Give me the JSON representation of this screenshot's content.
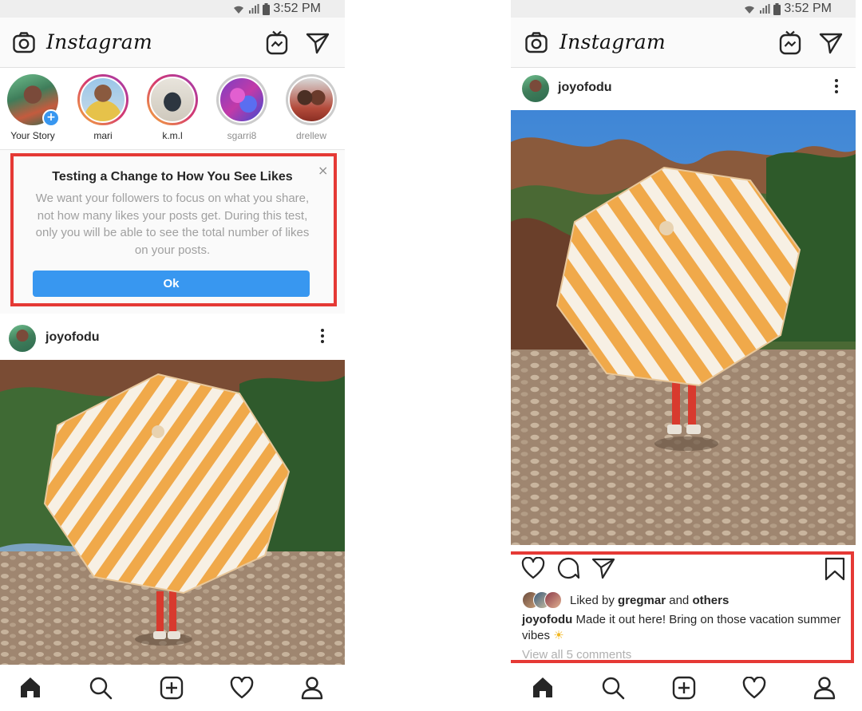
{
  "status_bar": {
    "time": "3:52 PM"
  },
  "app": {
    "logo_text": "Instagram"
  },
  "stories": [
    {
      "label": "Your Story",
      "ring": "none",
      "has_add": true,
      "add_symbol": "+"
    },
    {
      "label": "mari",
      "ring": "active"
    },
    {
      "label": "k.m.l",
      "ring": "active"
    },
    {
      "label": "sgarri8",
      "ring": "seen"
    },
    {
      "label": "drellew",
      "ring": "seen"
    }
  ],
  "notice": {
    "title": "Testing a Change to How You See Likes",
    "body": "We want your followers to focus on what you share, not how many likes your posts get. During this test, only you will be able to see the total number of likes on your posts.",
    "close_symbol": "×",
    "button_label": "Ok"
  },
  "post": {
    "username": "joyofodu",
    "liked_prefix": "Liked by ",
    "liked_user": "gregmar",
    "liked_mid": " and ",
    "liked_others": "others",
    "caption_user": "joyofodu",
    "caption_text": " Made it out here! Bring on those vacation summer vibes ",
    "caption_emoji": "☀",
    "comments_link": "View all 5 comments"
  },
  "icons": {
    "camera": "camera-icon",
    "igtv": "igtv-icon",
    "direct": "direct-send-icon",
    "home": "home-icon",
    "search": "search-icon",
    "add": "add-post-icon",
    "activity": "heart-icon",
    "profile": "profile-icon",
    "like": "like-heart-icon",
    "comment": "comment-icon",
    "share": "share-icon",
    "save": "bookmark-icon"
  },
  "colors": {
    "accent": "#3897f0",
    "highlight_box": "#e53935",
    "story_ring": "#d63a6d"
  }
}
